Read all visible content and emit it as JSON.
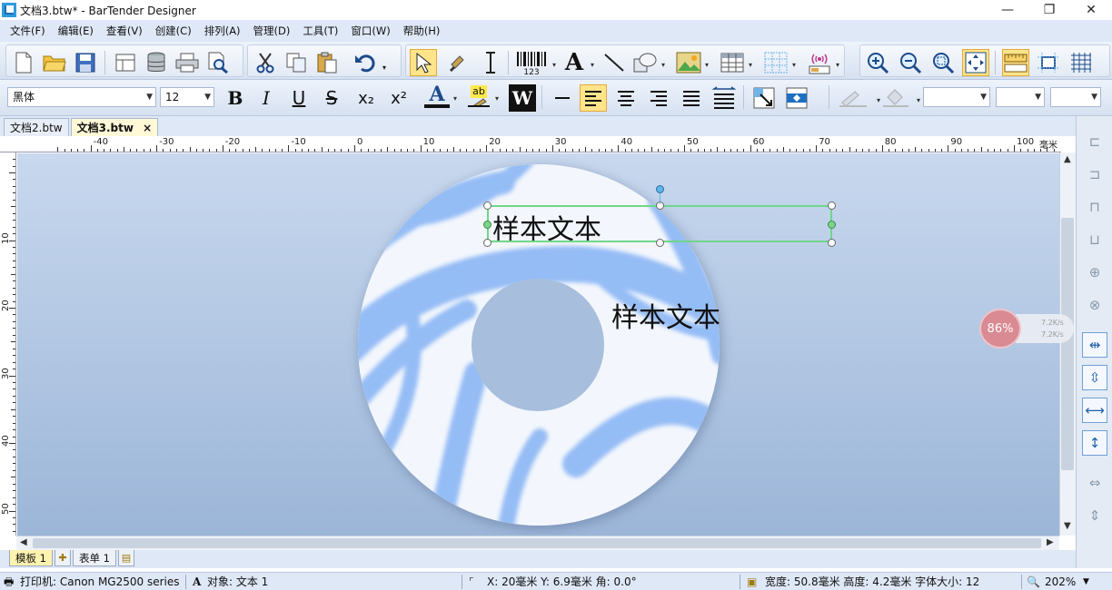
{
  "window": {
    "title": "文档3.btw* - BarTender Designer",
    "minimize": "—",
    "restore": "❐",
    "close": "✕"
  },
  "menu": [
    "文件(F)",
    "编辑(E)",
    "查看(V)",
    "创建(C)",
    "排列(A)",
    "管理(D)",
    "工具(T)",
    "窗口(W)",
    "帮助(H)"
  ],
  "toolbar1": {
    "barcode_caption": "123"
  },
  "format_bar": {
    "font_name": "黑体",
    "font_size": "12",
    "bold": "B",
    "italic": "I",
    "underline": "U",
    "strike": "S",
    "subscript": "x₂",
    "superscript": "x²",
    "font_color_letter": "A",
    "highlight_letter": "ab",
    "wrap_letter": "W"
  },
  "doc_tabs": [
    {
      "label": "文档2.btw",
      "active": false
    },
    {
      "label": "文档3.btw",
      "active": true
    }
  ],
  "doc_tab_close": "×",
  "ruler": {
    "h_labels": [
      "-40",
      "-30",
      "-20",
      "-10",
      "0",
      "10",
      "20",
      "30",
      "40",
      "50",
      "60",
      "70",
      "80",
      "90",
      "100",
      "毫米"
    ],
    "v_labels": [
      "10",
      "20",
      "30",
      "40",
      "50"
    ]
  },
  "canvas": {
    "text_selected": "样本文本",
    "text_second": "样本文本"
  },
  "sheet_tabs": {
    "template": "模板 1",
    "form": "表单 1"
  },
  "status": {
    "printer": "打印机: Canon MG2500 series",
    "object": "对象: 文本 1",
    "position": "X: 20毫米  Y: 6.9毫米  角: 0.0°",
    "size": "宽度: 50.8毫米  高度: 4.2毫米  字体大小: 12",
    "zoom": "202%"
  },
  "speed_widget": {
    "percent": "86%",
    "up": "7.2K/s",
    "down": "7.2K/s"
  },
  "colors": {
    "menu_bg": "#dfe8f6",
    "canvas_top": "#c8d8ee",
    "canvas_bottom": "#9cb6d8",
    "selection": "#6fd68a",
    "active_tool": "#ffe48a",
    "disc_pattern": "#8bb6f4"
  }
}
